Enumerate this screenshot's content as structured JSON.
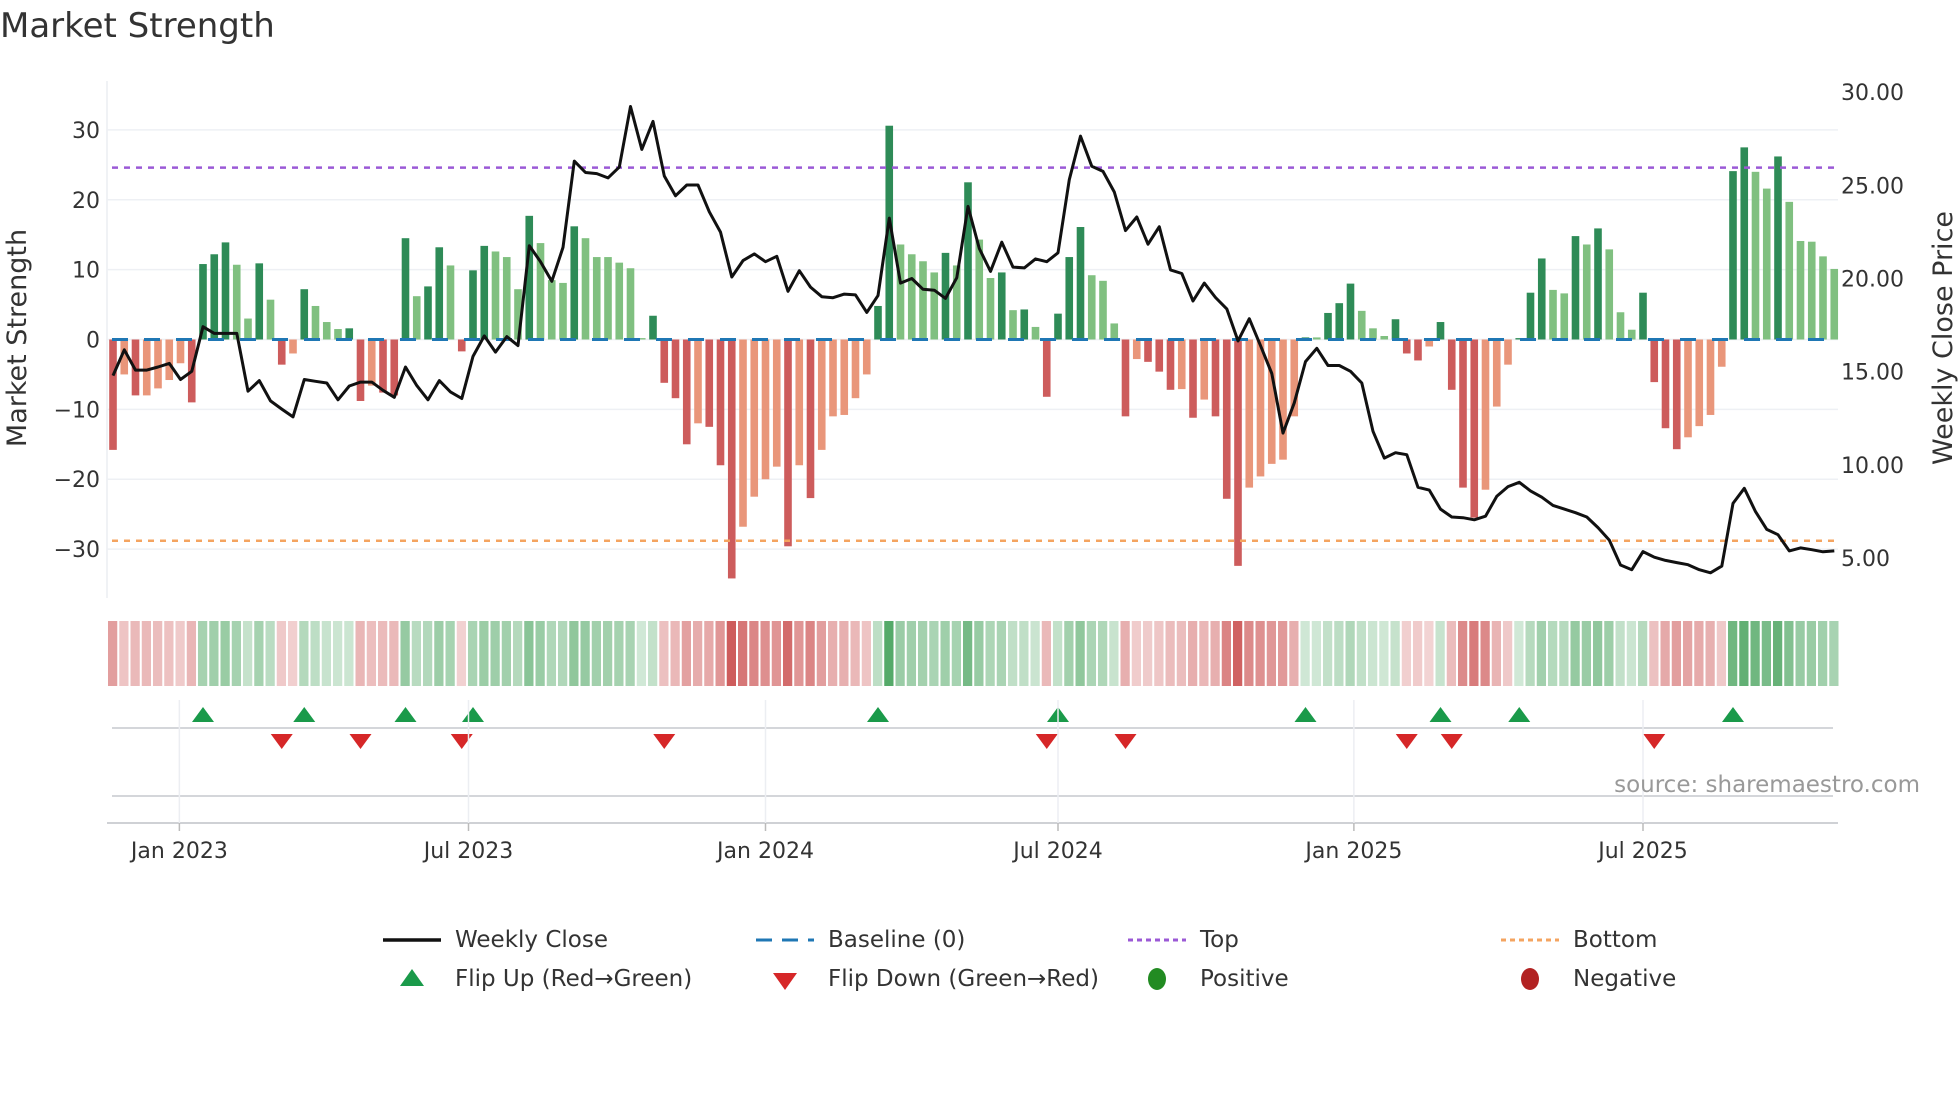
{
  "title": "Market Strength",
  "source": "source: sharemaestro.com",
  "legend": [
    {
      "key": "weekly_close",
      "label": "Weekly Close"
    },
    {
      "key": "baseline",
      "label": "Baseline (0)"
    },
    {
      "key": "top",
      "label": "Top"
    },
    {
      "key": "bottom",
      "label": "Bottom"
    },
    {
      "key": "flip_up",
      "label": "Flip Up (Red→Green)"
    },
    {
      "key": "flip_down",
      "label": "Flip Down (Green→Red)"
    },
    {
      "key": "positive",
      "label": "Positive"
    },
    {
      "key": "negative",
      "label": "Negative"
    }
  ],
  "colors": {
    "pos_dark": "#2e8b57",
    "pos_light": "#80c080",
    "neg_dark": "#cd5c5c",
    "neg_light": "#e9967a",
    "line": "#111111",
    "baseline": "#1f77b4",
    "top": "#9b59d6",
    "bottom": "#f4a460",
    "flip_up": "#1a9a4a",
    "flip_down": "#d62728",
    "positive": "#228b22",
    "negative": "#b22222"
  },
  "chart_data": {
    "type": "bar",
    "title": "Market Strength",
    "xlabel": "",
    "ylabel": "Market Strength",
    "y2label": "Weekly Close Price",
    "ylim": [
      -37,
      37
    ],
    "y2lim": [
      2.85,
      30.6
    ],
    "yticks": [
      {
        "v": 30,
        "label": "30"
      },
      {
        "v": 20,
        "label": "20"
      },
      {
        "v": 10,
        "label": "10"
      },
      {
        "v": 0,
        "label": "0"
      },
      {
        "v": -10,
        "label": "−10"
      },
      {
        "v": -20,
        "label": "−20"
      },
      {
        "v": -30,
        "label": "−30"
      }
    ],
    "y2ticks": [
      {
        "v": 30,
        "label": "30.00"
      },
      {
        "v": 25,
        "label": "25.00"
      },
      {
        "v": 20,
        "label": "20.00"
      },
      {
        "v": 15,
        "label": "15.00"
      },
      {
        "v": 10,
        "label": "10.00"
      },
      {
        "v": 5,
        "label": "5.00"
      }
    ],
    "xticks": [
      {
        "week": 5.9,
        "label": "Jan 2023"
      },
      {
        "week": 31.6,
        "label": "Jul 2023"
      },
      {
        "week": 58,
        "label": "Jan 2024"
      },
      {
        "week": 84,
        "label": "Jul 2024"
      },
      {
        "week": 110.3,
        "label": "Jan 2025"
      },
      {
        "week": 136,
        "label": "Jul 2025"
      }
    ],
    "top_level": 24.6,
    "bottom_level": -28.8,
    "baseline": 0,
    "strength": [
      -15.8,
      -5,
      -8,
      -8,
      -7,
      -5.8,
      -3.4,
      -9,
      10.8,
      12.2,
      13.9,
      10.7,
      3,
      10.9,
      5.7,
      -3.6,
      -2,
      7.2,
      4.8,
      2.5,
      1.5,
      1.6,
      -8.8,
      -6.6,
      -7.6,
      -8,
      14.5,
      6.2,
      7.6,
      13.2,
      10.6,
      -1.7,
      9.9,
      13.4,
      12.6,
      11.8,
      7.2,
      17.7,
      13.8,
      8.5,
      8.1,
      16.2,
      14.5,
      11.8,
      11.8,
      11,
      10.2,
      0.2,
      3.4,
      -6.2,
      -8.4,
      -15,
      -12,
      -12.5,
      -18,
      -34.2,
      -26.8,
      -22.5,
      -20,
      -18.2,
      -29.6,
      -18,
      -22.7,
      -15.8,
      -11,
      -10.8,
      -8.4,
      -5,
      4.8,
      30.6,
      13.6,
      12.2,
      11.2,
      9.6,
      12.4,
      10.6,
      22.5,
      14.3,
      8.8,
      9.6,
      4.2,
      4.3,
      1.8,
      -8.2,
      3.7,
      11.8,
      16.1,
      9.2,
      8.4,
      2.3,
      -11,
      -2.8,
      -3.2,
      -4.6,
      -7.2,
      -7.1,
      -11.2,
      -8.6,
      -11,
      -22.8,
      -32.4,
      -21.2,
      -19.6,
      -17.8,
      -17.2,
      -11,
      0.3,
      0.3,
      3.8,
      5.2,
      8,
      4.1,
      1.6,
      0.5,
      2.9,
      -2,
      -3,
      -1,
      2.5,
      -7.2,
      -21.2,
      -25.5,
      -21.5,
      -9.6,
      -3.6,
      0.2,
      6.7,
      11.6,
      7.1,
      6.6,
      14.8,
      13.6,
      15.9,
      12.9,
      3.9,
      1.4,
      6.7,
      -6.1,
      -12.7,
      -15.7,
      -14,
      -12.4,
      -10.8,
      -3.9,
      24.1,
      27.5,
      24,
      21.6,
      26.2,
      19.7,
      14.1,
      14,
      11.9,
      10.1
    ],
    "weekly_close": [
      14.79,
      16.17,
      15.08,
      15.08,
      15.25,
      15.44,
      14.58,
      15.02,
      17.41,
      17.05,
      17.05,
      17.05,
      13.95,
      14.52,
      13.43,
      12.99,
      12.57,
      14.58,
      14.48,
      14.39,
      13.49,
      14.23,
      14.44,
      14.44,
      14.0,
      13.62,
      15.25,
      14.25,
      13.49,
      14.52,
      13.91,
      13.56,
      15.82,
      16.92,
      16.05,
      16.88,
      16.4,
      21.76,
      20.9,
      19.85,
      21.67,
      26.3,
      25.69,
      25.63,
      25.4,
      25.98,
      29.23,
      26.93,
      28.43,
      25.5,
      24.44,
      25.02,
      25.02,
      23.58,
      22.49,
      20.08,
      20.96,
      21.32,
      20.9,
      21.19,
      19.31,
      20.42,
      19.54,
      19.02,
      18.97,
      19.16,
      19.12,
      18.18,
      19.08,
      23.24,
      19.75,
      20,
      19.42,
      19.37,
      18.93,
      20.04,
      23.87,
      21.61,
      20.38,
      21.95,
      20.61,
      20.57,
      21.05,
      20.9,
      21.38,
      25.31,
      27.64,
      26.02,
      25.75,
      24.64,
      22.57,
      23.3,
      21.84,
      22.78,
      20.46,
      20.27,
      18.79,
      19.75,
      18.98,
      18.37,
      16.65,
      17.84,
      16.4,
      14.9,
      11.7,
      13.33,
      15.54,
      16.25,
      15.33,
      15.33,
      15.02,
      14.39,
      11.8,
      10.36,
      10.65,
      10.54,
      8.79,
      8.64,
      7.62,
      7.2,
      7.16,
      7.05,
      7.24,
      8.31,
      8.83,
      9.06,
      8.6,
      8.26,
      7.82,
      7.62,
      7.43,
      7.2,
      6.63,
      5.96,
      4.62,
      4.37,
      5.34,
      5.04,
      4.87,
      4.75,
      4.64,
      4.37,
      4.2,
      4.56,
      7.93,
      8.74,
      7.49,
      6.53,
      6.25,
      5.38,
      5.54,
      5.44,
      5.33,
      5.38
    ]
  }
}
